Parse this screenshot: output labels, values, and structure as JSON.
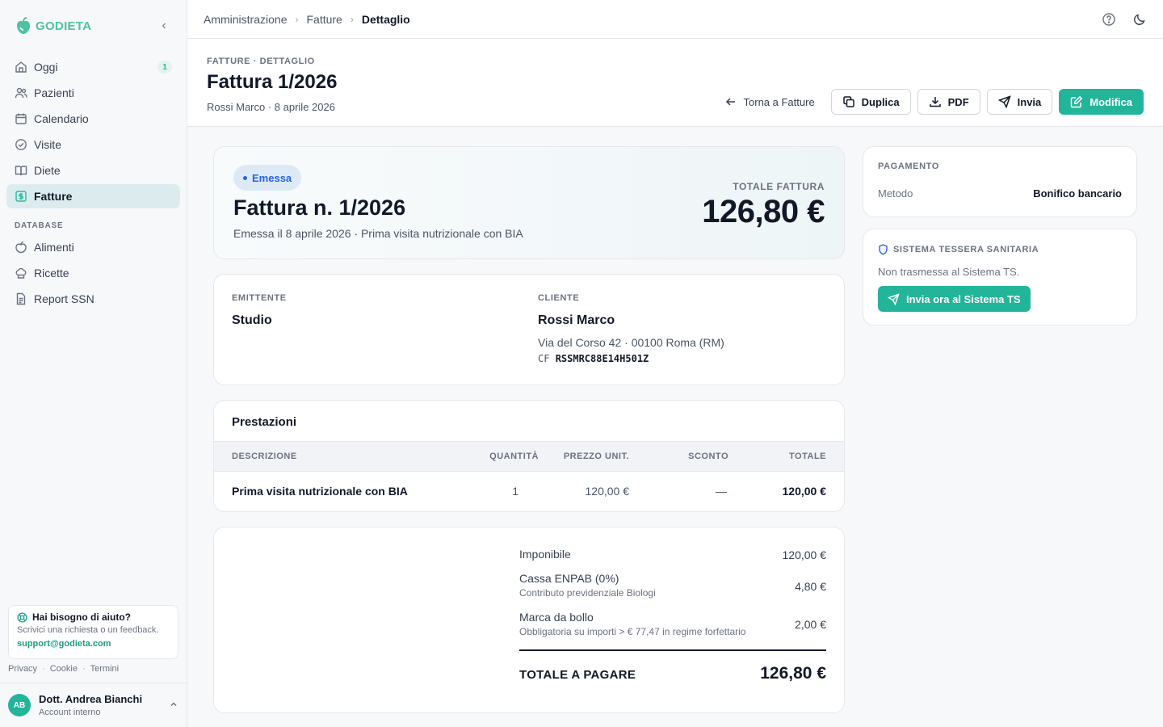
{
  "app": {
    "brand": "GODIETA"
  },
  "sidebar": {
    "items": [
      {
        "label": "Oggi",
        "icon": "home-icon",
        "badge": "1"
      },
      {
        "label": "Pazienti",
        "icon": "users-icon"
      },
      {
        "label": "Calendario",
        "icon": "calendar-icon"
      },
      {
        "label": "Visite",
        "icon": "check-circle-icon"
      },
      {
        "label": "Diete",
        "icon": "book-icon"
      },
      {
        "label": "Fatture",
        "icon": "dollar-icon",
        "active": true
      }
    ],
    "database_section": "DATABASE",
    "database_items": [
      {
        "label": "Alimenti",
        "icon": "apple-icon"
      },
      {
        "label": "Ricette",
        "icon": "chef-hat-icon"
      },
      {
        "label": "Report SSN",
        "icon": "file-text-icon"
      }
    ],
    "help": {
      "title": "Hai bisogno di aiuto?",
      "subtitle": "Scrivici una richiesta o un feedback.",
      "email": "support@godieta.com"
    },
    "legal": [
      "Privacy",
      "Cookie",
      "Termini"
    ],
    "user": {
      "initials": "AB",
      "name": "Dott. Andrea Bianchi",
      "role": "Account interno"
    }
  },
  "breadcrumb": [
    "Amministrazione",
    "Fatture",
    "Dettaglio"
  ],
  "header": {
    "eyebrow": "FATTURE · DETTAGLIO",
    "title": "Fattura 1/2026",
    "subtitle": "Rossi Marco · 8 aprile 2026",
    "actions": {
      "back": "Torna a Fatture",
      "duplicate": "Duplica",
      "pdf": "PDF",
      "send": "Invia",
      "edit": "Modifica"
    }
  },
  "invoice": {
    "status": "Emessa",
    "title": "Fattura n. 1/2026",
    "subtitle": "Emessa il 8 aprile 2026 · Prima visita nutrizionale con BIA",
    "total_label": "TOTALE FATTURA",
    "total": "126,80 €"
  },
  "parties": {
    "issuer_label": "EMITTENTE",
    "issuer_name": "Studio",
    "client_label": "CLIENTE",
    "client_name": "Rossi Marco",
    "client_address": "Via del Corso 42 · 00100 Roma (RM)",
    "cf_label": "CF",
    "cf_value": "RSSMRC88E14H501Z"
  },
  "services": {
    "title": "Prestazioni",
    "columns": [
      "DESCRIZIONE",
      "QUANTITÀ",
      "PREZZO UNIT.",
      "SCONTO",
      "TOTALE"
    ],
    "rows": [
      {
        "description": "Prima visita nutrizionale con BIA",
        "qty": "1",
        "unit_price": "120,00 €",
        "discount": "—",
        "total": "120,00 €"
      }
    ]
  },
  "totals": {
    "imponibile_label": "Imponibile",
    "imponibile": "120,00 €",
    "cassa_label": "Cassa ENPAB (0%)",
    "cassa_sub": "Contributo previdenziale Biologi",
    "cassa": "4,80 €",
    "bollo_label": "Marca da bollo",
    "bollo_sub": "Obbligatoria su importi > € 77,47 in regime forfettario",
    "bollo": "2,00 €",
    "grand_label": "TOTALE A PAGARE",
    "grand": "126,80 €"
  },
  "payment": {
    "label": "PAGAMENTO",
    "method_label": "Metodo",
    "method": "Bonifico bancario"
  },
  "sistema_ts": {
    "label": "SISTEMA TESSERA SANITARIA",
    "status": "Non trasmessa al Sistema TS.",
    "button": "Invia ora al Sistema TS"
  },
  "colors": {
    "accent": "#22b59a",
    "status_blue": "#2563eb"
  }
}
